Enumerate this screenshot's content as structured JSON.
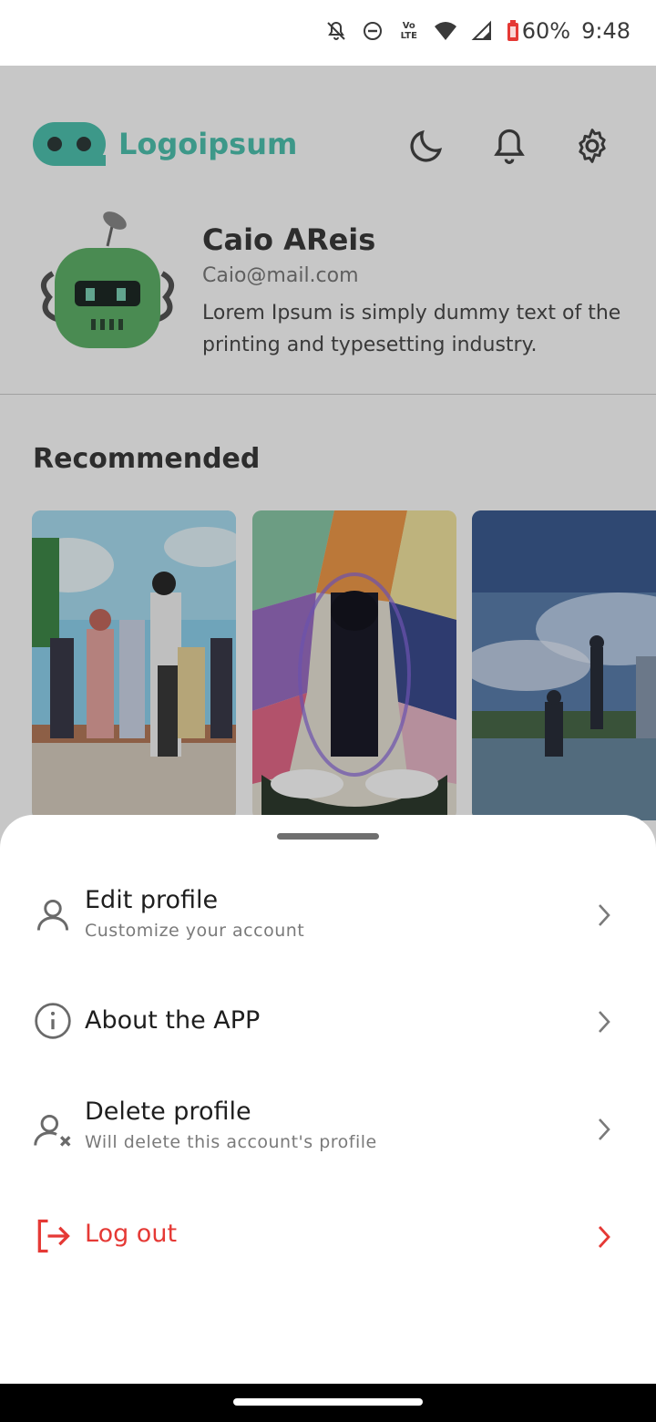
{
  "status_bar": {
    "battery": "60%",
    "time": "9:48",
    "icons": [
      "notifications-off-icon",
      "do-not-disturb-icon",
      "volte-icon",
      "wifi-icon",
      "signal-icon",
      "battery-icon"
    ],
    "lte_label": "LTE",
    "volte_label": "Vo"
  },
  "header": {
    "logo_text": "Logoipsum",
    "brand_color": "#4fc3b0",
    "actions": [
      "moon-icon",
      "bell-icon",
      "gear-icon"
    ]
  },
  "profile": {
    "name": "Caio AReis",
    "email": "Caio@mail.com",
    "bio": "Lorem Ipsum is simply dummy text of the printing and typesetting industry."
  },
  "recommended": {
    "title": "Recommended",
    "cards": [
      "anime-poster-1",
      "anime-poster-2",
      "anime-poster-3"
    ]
  },
  "sheet": {
    "items": [
      {
        "title": "Edit profile",
        "subtitle": "Customize your account",
        "icon": "user-icon"
      },
      {
        "title": "About the APP",
        "subtitle": "",
        "icon": "info-icon"
      },
      {
        "title": "Delete profile",
        "subtitle": "Will delete this account's profile",
        "icon": "user-remove-icon"
      },
      {
        "title": "Log out",
        "subtitle": "",
        "icon": "logout-icon"
      }
    ],
    "danger_color": "#e53935"
  }
}
